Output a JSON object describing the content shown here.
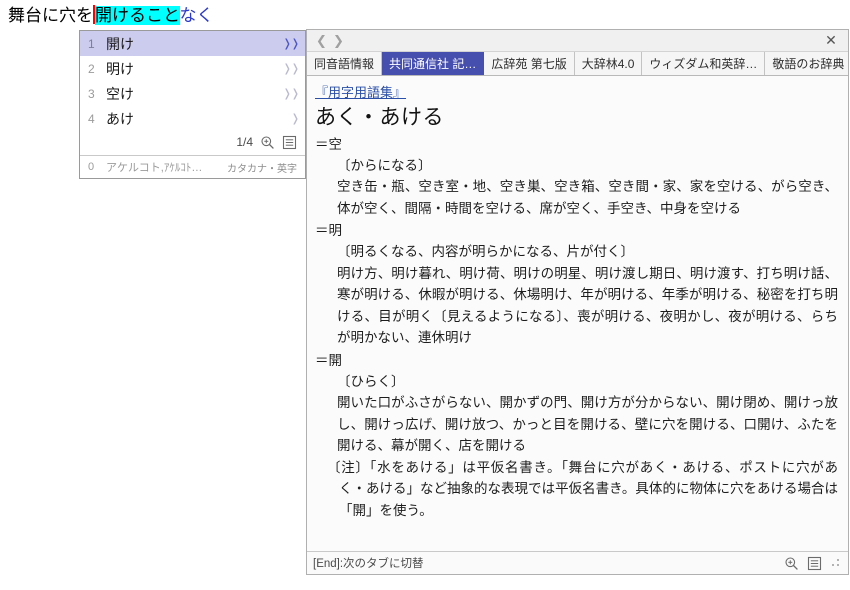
{
  "composition": {
    "prefix": "舞台に穴を",
    "converted": "開けること",
    "pending": "なく",
    "caret": ""
  },
  "candidate_window": {
    "items": [
      {
        "index": "1",
        "text": "開け",
        "arrow": "❭❭",
        "selected": true
      },
      {
        "index": "2",
        "text": "明け",
        "arrow": "❭❭",
        "selected": false
      },
      {
        "index": "3",
        "text": "空け",
        "arrow": "❭❭",
        "selected": false
      },
      {
        "index": "4",
        "text": "あけ",
        "arrow": "❭",
        "selected": false
      }
    ],
    "page_indicator": "1/4",
    "zoom_icon": "magnifier-plus-icon",
    "list_icon": "list-view-icon",
    "status": {
      "number": "0",
      "reading": "アケルコト,ｱｹﾙｺﾄ…",
      "mode": "カタカナ・英字"
    }
  },
  "dict_panel": {
    "nav_prev": "❮",
    "nav_next": "❯",
    "close_label": "✕",
    "tabs": [
      {
        "label": "同音語情報",
        "active": false
      },
      {
        "label": "共同通信社 記…",
        "active": true
      },
      {
        "label": "広辞苑 第七版",
        "active": false
      },
      {
        "label": "大辞林4.0",
        "active": false
      },
      {
        "label": "ウィズダム和英辞…",
        "active": false
      },
      {
        "label": "敬語のお辞典",
        "active": false
      }
    ],
    "source": "『用字用語集』",
    "headword": "あく・あける",
    "senses": [
      {
        "marker": "＝空",
        "gloss": "〔からになる〕",
        "examples": "空き缶・瓶、空き室・地、空き巣、空き箱、空き間・家、家を空ける、がら空き、体が空く、間隔・時間を空ける、席が空く、手空き、中身を空ける"
      },
      {
        "marker": "＝明",
        "gloss": "〔明るくなる、内容が明らかになる、片が付く〕",
        "examples": "明け方、明け暮れ、明け荷、明けの明星、明け渡し期日、明け渡す、打ち明け話、寒が明ける、休暇が明ける、休場明け、年が明ける、年季が明ける、秘密を打ち明ける、目が明く〔見えるようになる〕、喪が明ける、夜明かし、夜が明ける、らちが明かない、連休明け"
      },
      {
        "marker": "＝開",
        "gloss": "〔ひらく〕",
        "examples": "開いた口がふさがらない、開かずの門、開け方が分からない、開け閉め、開けっ放し、開けっ広げ、開け放つ、かっと目を開ける、壁に穴を開ける、口開け、ふたを開ける、幕が開く、店を開ける"
      }
    ],
    "note": "〔注〕「水をあける」は平仮名書き。「舞台に穴があく・あける、ポストに穴があく・あける」など抽象的な表現では平仮名書き。具体的に物体に穴をあける場合は「開」を使う。",
    "statusbar": {
      "hint": "[End]:次のタブに切替",
      "zoom_icon": "magnifier-plus-icon",
      "list_icon": "list-view-icon",
      "resize_grip": "resize-grip"
    }
  },
  "colors": {
    "composition_highlight": "#00ffff",
    "caret": "#ff0000",
    "pending_text": "#2b3acc",
    "candidate_selected_bg": "#ccccee",
    "tab_active_bg": "#474fae",
    "source_link": "#2a4fa8"
  }
}
